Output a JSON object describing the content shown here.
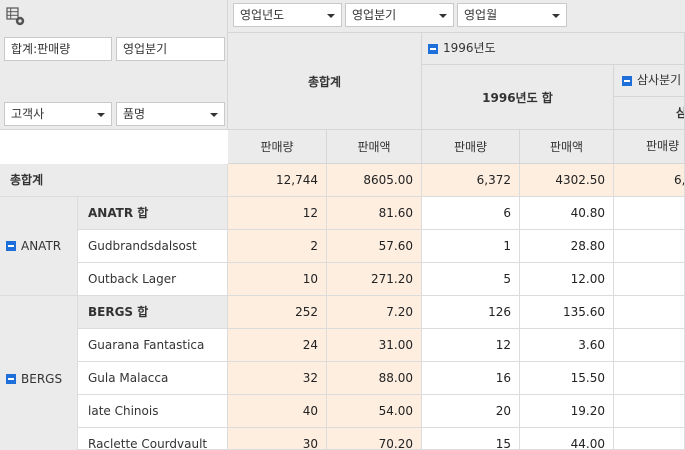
{
  "filters": {
    "column_fields": [
      {
        "label": "영업년도"
      },
      {
        "label": "영업분기"
      },
      {
        "label": "영업월"
      }
    ],
    "data_field": "합계:판매량",
    "pending_field": "영업분기",
    "row_fields": [
      {
        "label": "고객사"
      },
      {
        "label": "품명"
      }
    ]
  },
  "headers": {
    "grand_total": "총합계",
    "year_group": "1996년도",
    "year_total": "1996년도 합",
    "quarter_group": "삼사분기",
    "quarter_partial": "삼",
    "measure_qty": "판매량",
    "measure_amt": "판매액"
  },
  "grand_total_row": {
    "label": "총합계",
    "total_qty": "12,744",
    "total_amt": "8605.00",
    "y_qty": "6,372",
    "y_amt": "4302.50",
    "q_qty": "6,"
  },
  "groups": [
    {
      "customer": "ANATR",
      "subtotal_label": "ANATR 합",
      "subtotal": {
        "total_qty": "12",
        "total_amt": "81.60",
        "y_qty": "6",
        "y_amt": "40.80"
      },
      "items": [
        {
          "name": "Gudbrandsdalsost",
          "total_qty": "2",
          "total_amt": "57.60",
          "y_qty": "1",
          "y_amt": "28.80"
        },
        {
          "name": "Outback Lager",
          "total_qty": "10",
          "total_amt": "271.20",
          "y_qty": "5",
          "y_amt": "12.00"
        }
      ]
    },
    {
      "customer": "BERGS",
      "subtotal_label": "BERGS 합",
      "subtotal": {
        "total_qty": "252",
        "total_amt": "7.20",
        "y_qty": "126",
        "y_amt": "135.60"
      },
      "items": [
        {
          "name": "Guarana Fantastica",
          "total_qty": "24",
          "total_amt": "31.00",
          "y_qty": "12",
          "y_amt": "3.60"
        },
        {
          "name": "Gula Malacca",
          "total_qty": "32",
          "total_amt": "88.00",
          "y_qty": "16",
          "y_amt": "15.50"
        },
        {
          "name": "late Chinois",
          "total_qty": "40",
          "total_amt": "54.00",
          "y_qty": "20",
          "y_amt": "19.20"
        },
        {
          "name": "Raclette Courdvault",
          "total_qty": "30",
          "total_amt": "70.20",
          "y_qty": "15",
          "y_amt": "44.00"
        }
      ]
    }
  ]
}
